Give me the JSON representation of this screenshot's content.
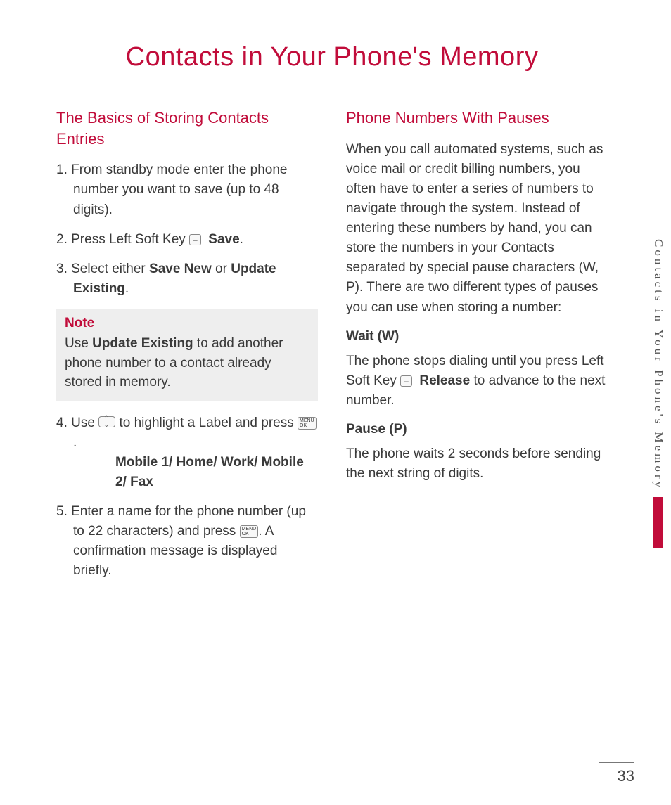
{
  "title": "Contacts in Your Phone's Memory",
  "page_number": "33",
  "side_label": "Contacts in Your Phone's Memory",
  "left": {
    "heading": "The Basics of Storing Contacts Entries",
    "step1": "1. From standby mode enter the phone number you want to save (up to 48 digits).",
    "step2_prefix": "2. Press Left Soft Key ",
    "step2_bold": "Save",
    "step2_suffix": ".",
    "step3_prefix": "3. Select either ",
    "step3_b1": "Save New",
    "step3_mid": " or ",
    "step3_b2": "Update Existing",
    "step3_suffix": ".",
    "note_title": "Note",
    "note_prefix": "Use ",
    "note_bold": "Update Existing",
    "note_suffix": " to add another phone number to a contact already stored in memory.",
    "step4_prefix": "4. Use ",
    "step4_mid": " to highlight a Label and press ",
    "step4_suffix": ".",
    "labels": "Mobile 1/ Home/ Work/ Mobile 2/ Fax",
    "step5_prefix": "5. Enter a name for the phone number (up to 22 characters) and press ",
    "step5_suffix": ". A confirmation message is displayed briefly."
  },
  "right": {
    "heading": "Phone Numbers With Pauses",
    "intro": "When you call automated systems, such as voice mail or credit billing numbers, you often have to enter a series of numbers to navigate through the system. Instead of entering these numbers by hand, you can store the numbers in your Contacts separated by special pause characters (W, P). There are two different types of pauses you can use when storing a number:",
    "wait_head": "Wait (W)",
    "wait_prefix": "The phone stops dialing until you press Left Soft Key ",
    "wait_bold": "Release",
    "wait_suffix": " to advance to the next number.",
    "pause_head": "Pause (P)",
    "pause_body": "The phone waits 2 seconds before sending the next string of digits."
  },
  "icons": {
    "softkey": "–",
    "ok_top": "MENU",
    "ok_bottom": "OK"
  }
}
